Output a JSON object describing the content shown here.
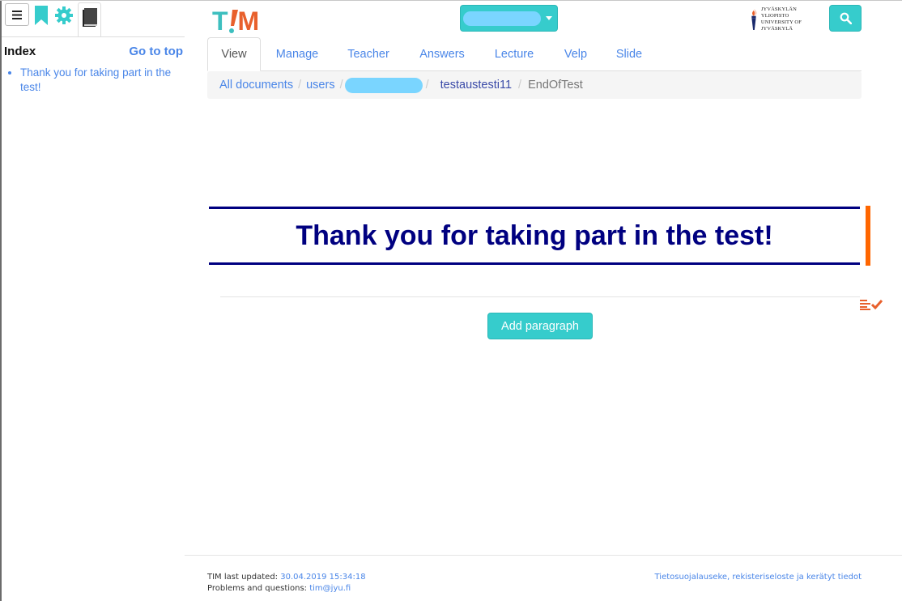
{
  "sidebar": {
    "index_title": "Index",
    "go_to_top": "Go to top",
    "index_items": [
      "Thank you for taking part in the test!"
    ],
    "icons": [
      "menu-icon",
      "bookmark-icon",
      "gear-icon",
      "book-icon"
    ]
  },
  "header": {
    "logo_left": "T",
    "logo_right": "M",
    "university_line1": "JYVÄSKYLÄN YLIOPISTO",
    "university_line2": "UNIVERSITY OF JYVÄSKYLÄ"
  },
  "tabs": [
    "View",
    "Manage",
    "Teacher",
    "Answers",
    "Lecture",
    "Velp",
    "Slide"
  ],
  "breadcrumb": {
    "all_documents": "All documents",
    "users": "users",
    "folder": "testaustesti11",
    "current": "EndOfTest",
    "separator": "/"
  },
  "document": {
    "heading": "Thank you for taking part in the test!",
    "add_paragraph": "Add paragraph"
  },
  "footer": {
    "updated_label": "TIM last updated:",
    "updated_value": "30.04.2019 15:34:18",
    "problems_label": "Problems and questions:",
    "problems_email": "tim@jyu.fi",
    "privacy_link": "Tietosuojalauseke, rekisteriseloste ja kerätyt tiedot"
  },
  "colors": {
    "accent": "#36cccc",
    "link": "#4a86e8",
    "heading": "#000080",
    "orange": "#ff6600"
  }
}
